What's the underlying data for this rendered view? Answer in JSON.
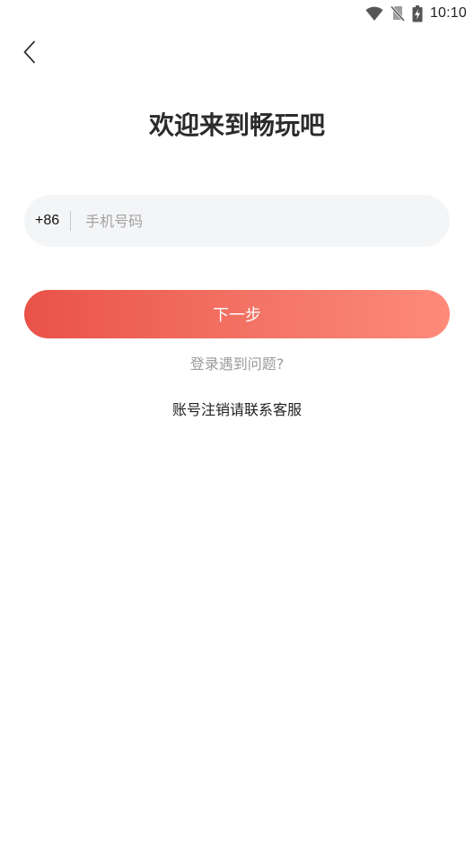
{
  "status_bar": {
    "time": "10:10",
    "icons": [
      "wifi-icon",
      "no-sim-icon",
      "battery-charging-icon"
    ]
  },
  "header": {
    "back_icon": "chevron-left-icon"
  },
  "main": {
    "title": "欢迎来到畅玩吧",
    "phone": {
      "country_code": "+86",
      "placeholder": "手机号码",
      "value": ""
    },
    "next_label": "下一步",
    "help_link": "登录遇到问题?",
    "account_cancel_text": "账号注销请联系客服"
  },
  "colors": {
    "accent_start": "#ea5248",
    "accent_end": "#fe8a7a",
    "field_bg": "#f4f5f7"
  }
}
